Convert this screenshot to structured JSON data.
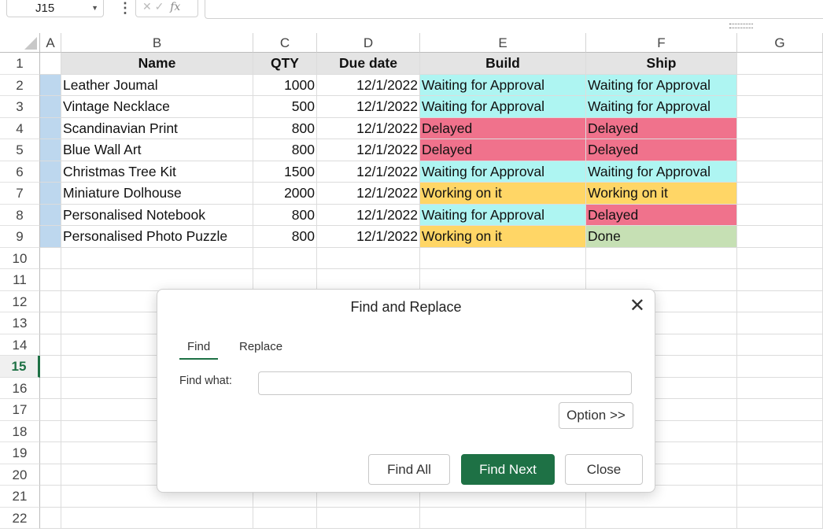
{
  "formula_bar": {
    "cell_ref": "J15",
    "cancel_glyph": "✕",
    "enter_glyph": "✓",
    "fx_label": "fx",
    "formula": ""
  },
  "columns": [
    "A",
    "B",
    "C",
    "D",
    "E",
    "F",
    "G"
  ],
  "rows": [
    "1",
    "2",
    "3",
    "4",
    "5",
    "6",
    "7",
    "8",
    "9",
    "10",
    "11",
    "12",
    "13",
    "14",
    "15",
    "16",
    "17",
    "18",
    "19",
    "20",
    "21",
    "22"
  ],
  "selected_row": "15",
  "table": {
    "headers": [
      "Name",
      "QTY",
      "Due date",
      "Build",
      "Ship"
    ],
    "records": [
      [
        "Leather Joumal",
        "1000",
        "12/1/2022",
        "Waiting for Approval",
        "Waiting for Approval"
      ],
      [
        "Vintage Necklace",
        "500",
        "12/1/2022",
        "Waiting for Approval",
        "Waiting for Approval"
      ],
      [
        "Scandinavian Print",
        "800",
        "12/1/2022",
        "Delayed",
        "Delayed"
      ],
      [
        "Blue Wall Art",
        "800",
        "12/1/2022",
        "Delayed",
        "Delayed"
      ],
      [
        "Christmas Tree Kit",
        "1500",
        "12/1/2022",
        "Waiting for Approval",
        "Waiting for Approval"
      ],
      [
        "Miniature Dolhouse",
        "2000",
        "12/1/2022",
        "Working on it",
        "Working on it"
      ],
      [
        "Personalised Notebook",
        "800",
        "12/1/2022",
        "Waiting for Approval",
        "Delayed"
      ],
      [
        "Personalised Photo Puzzle",
        "800",
        "12/1/2022",
        "Working on it",
        "Done"
      ]
    ]
  },
  "status_colors": {
    "Waiting for Approval": "#aef5f2",
    "Delayed": "#f0728c",
    "Working on it": "#ffd666",
    "Done": "#c6e0b4"
  },
  "header_fill": "#e4e4e4",
  "marker_fill": "#bdd7ee",
  "accent": "#1e7145",
  "dialog": {
    "title": "Find and Replace",
    "close_glyph": "✕",
    "tabs": [
      "Find",
      "Replace"
    ],
    "active_tab": "Find",
    "find_label": "Find what:",
    "find_value": "",
    "option_button": "Option >>",
    "find_all_button": "Find All",
    "find_next_button": "Find Next",
    "close_button": "Close"
  }
}
